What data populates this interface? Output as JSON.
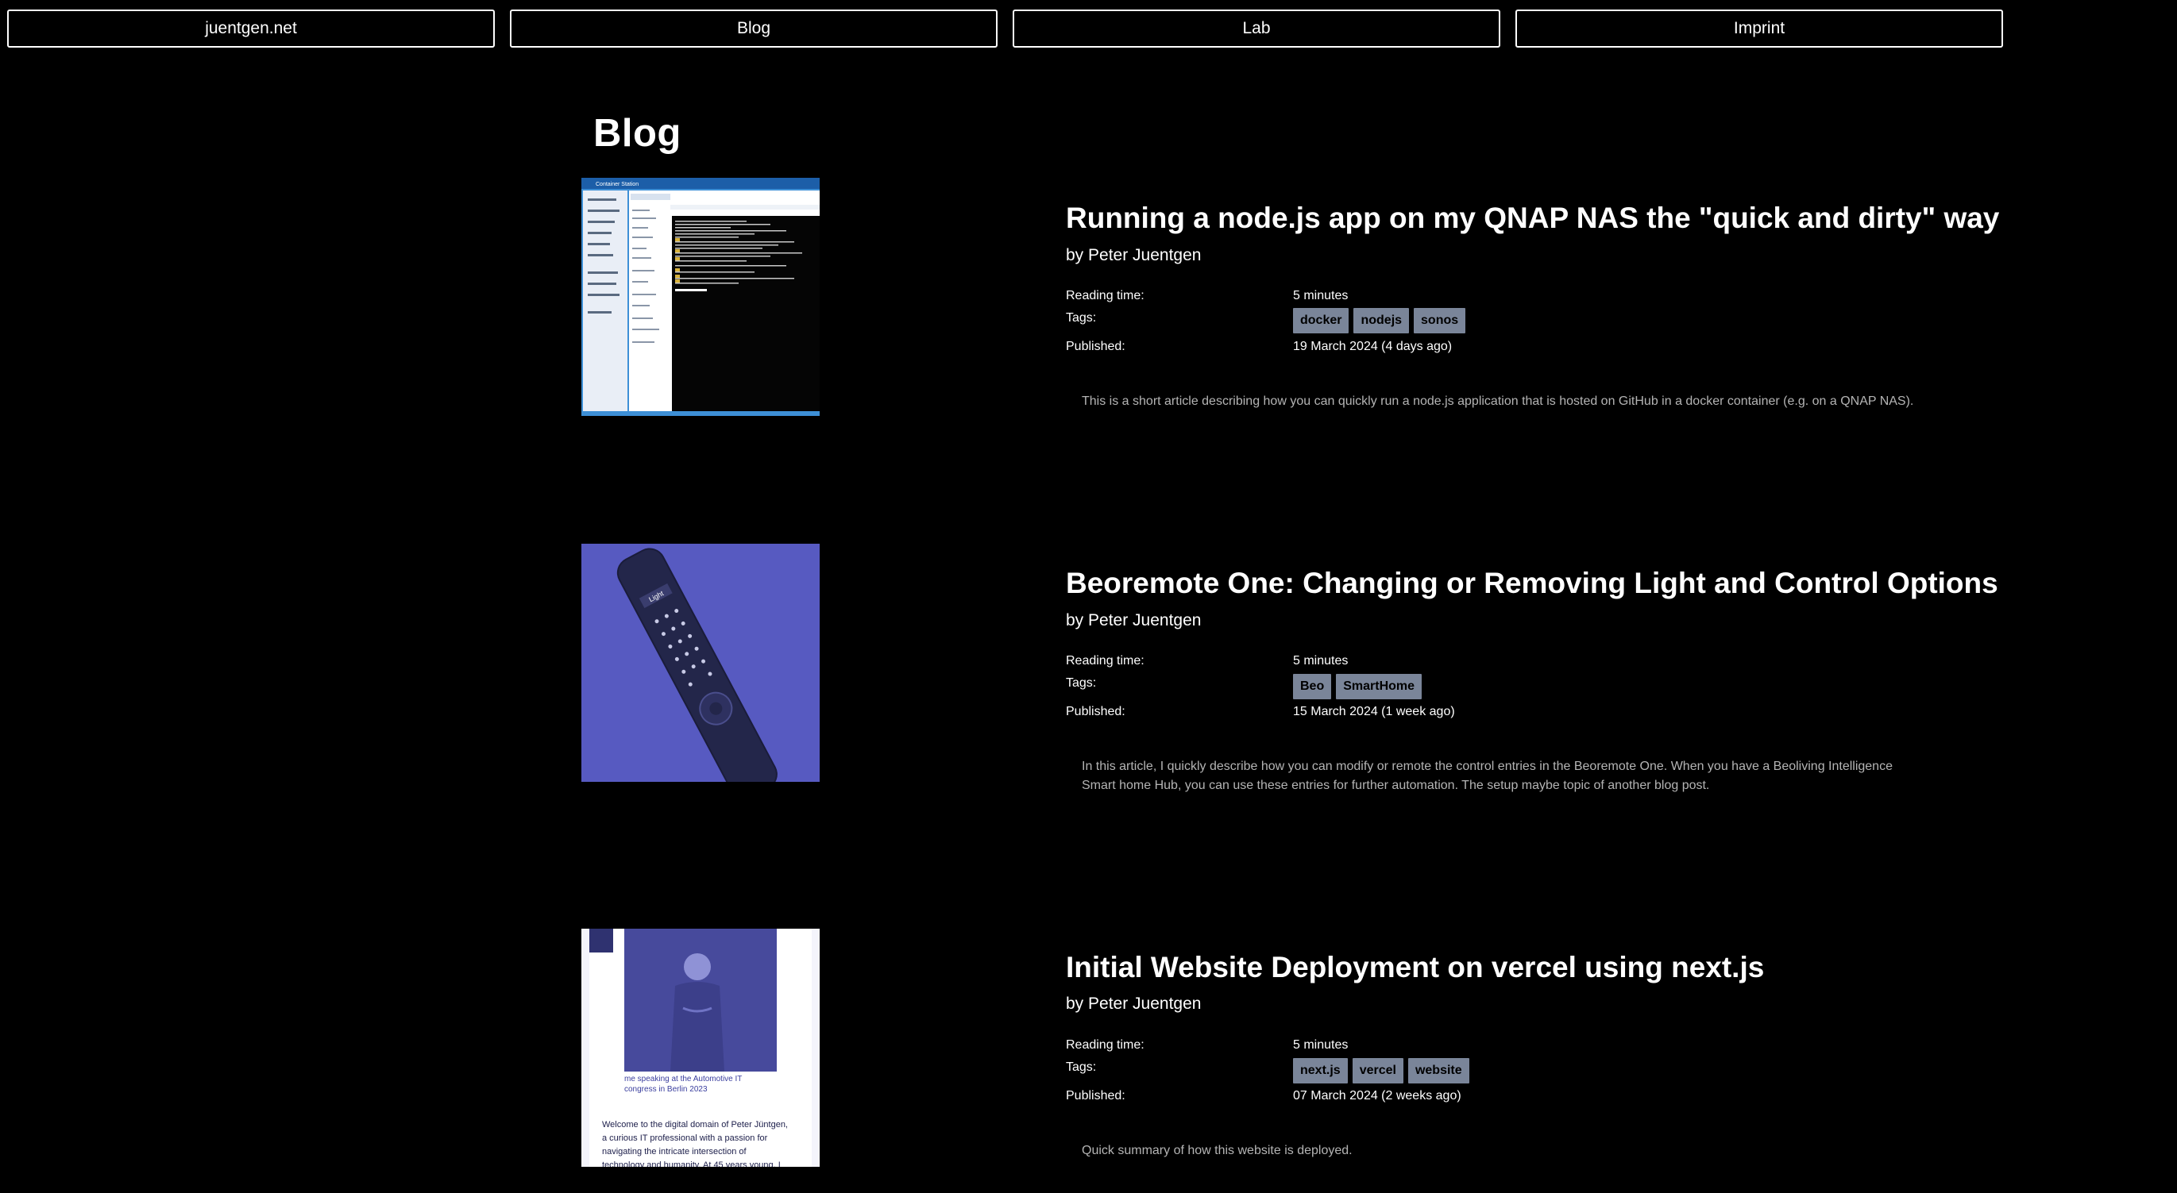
{
  "nav": {
    "items": [
      "juentgen.net",
      "Blog",
      "Lab",
      "Imprint"
    ]
  },
  "page": {
    "title": "Blog"
  },
  "labels": {
    "reading_time": "Reading time:",
    "tags": "Tags:",
    "published": "Published:"
  },
  "posts": [
    {
      "title": "Running a node.js app on my QNAP NAS the \"quick and dirty\" way",
      "author": "by Peter Juentgen",
      "reading_time": "5 minutes",
      "tags": [
        "docker",
        "nodejs",
        "sonos"
      ],
      "published": "19 March 2024 (4 days ago)",
      "excerpt": "This is a short article describing how you can quickly run a node.js application that is hosted on GitHub in a docker container (e.g. on a QNAP NAS).",
      "thumb": {
        "app_title": "Container Station"
      }
    },
    {
      "title": "Beoremote One: Changing or Removing Light and Control Options",
      "author": "by Peter Juentgen",
      "reading_time": "5 minutes",
      "tags": [
        "Beo",
        "SmartHome"
      ],
      "published": "15 March 2024 (1 week ago)",
      "excerpt": "In this article, I quickly describe how you can modify or remote the control entries in the Beoremote One. When you have a Beoliving Intelligence Smart home Hub, you can use these entries for further automation. The setup maybe topic of another blog post.",
      "thumb": {
        "screen_text": "Light"
      }
    },
    {
      "title": "Initial Website Deployment on vercel using next.js",
      "author": "by Peter Juentgen",
      "reading_time": "5 minutes",
      "tags": [
        "next.js",
        "vercel",
        "website"
      ],
      "published": "07 March 2024 (2 weeks ago)",
      "excerpt": "Quick summary of how this website is deployed.",
      "thumb": {
        "caption": "me speaking at the Automotive IT congress in Berlin 2023",
        "body": "Welcome to the digital domain of Peter Jüntgen, a curious IT professional with a passion for navigating the intricate intersection of technology and humanity. At 45 years young, I"
      }
    }
  ],
  "colors": {
    "background": "#000000",
    "text": "#ffffff",
    "tag_bg": "#7a8599",
    "excerpt": "#b4b4b4",
    "thumb_tint": "#5b5fc7"
  }
}
